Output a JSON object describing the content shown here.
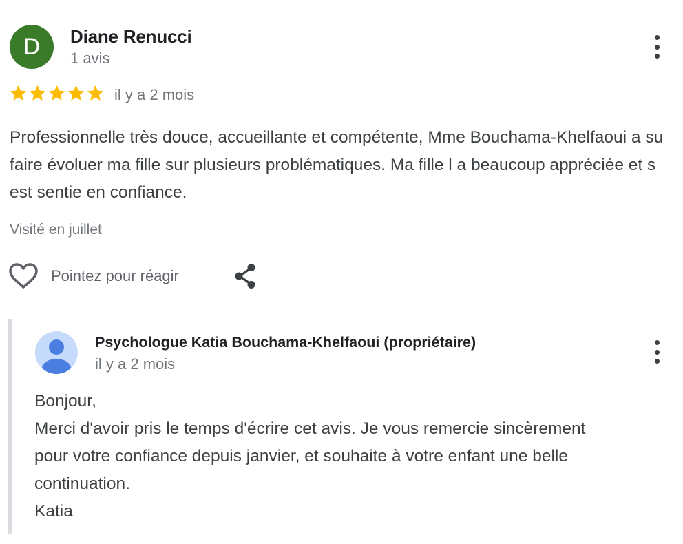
{
  "review": {
    "avatar_letter": "D",
    "avatar_color": "#3a7b2a",
    "reviewer_name": "Diane Renucci",
    "reviewer_count": "1 avis",
    "rating": 5,
    "rating_max": 5,
    "star_color": "#fbbc04",
    "time": "il y a 2 mois",
    "text": "Professionnelle très douce, accueillante et compétente, Mme Bouchama-Khelfaoui a su faire évoluer ma fille sur plusieurs problématiques. Ma fille l a beaucoup appréciée et s est sentie en confiance.",
    "visited": "Visité en juillet",
    "more_icon": "more-vert-icon"
  },
  "actions": {
    "react_icon": "heart-icon",
    "react_label": "Pointez pour réagir",
    "share_icon": "share-icon"
  },
  "response": {
    "owner_name": "Psychologue Katia Bouchama-Khelfaoui (propriétaire)",
    "owner_avatar_icon": "person-icon",
    "time": "il y a 2 mois",
    "lines": [
      "Bonjour,",
      "Merci d'avoir pris le temps d'écrire cet avis. Je vous remercie sincèrement",
      "pour votre confiance depuis janvier, et souhaite à votre enfant une belle",
      "continuation.",
      "Katia"
    ],
    "more_icon": "more-vert-icon"
  }
}
